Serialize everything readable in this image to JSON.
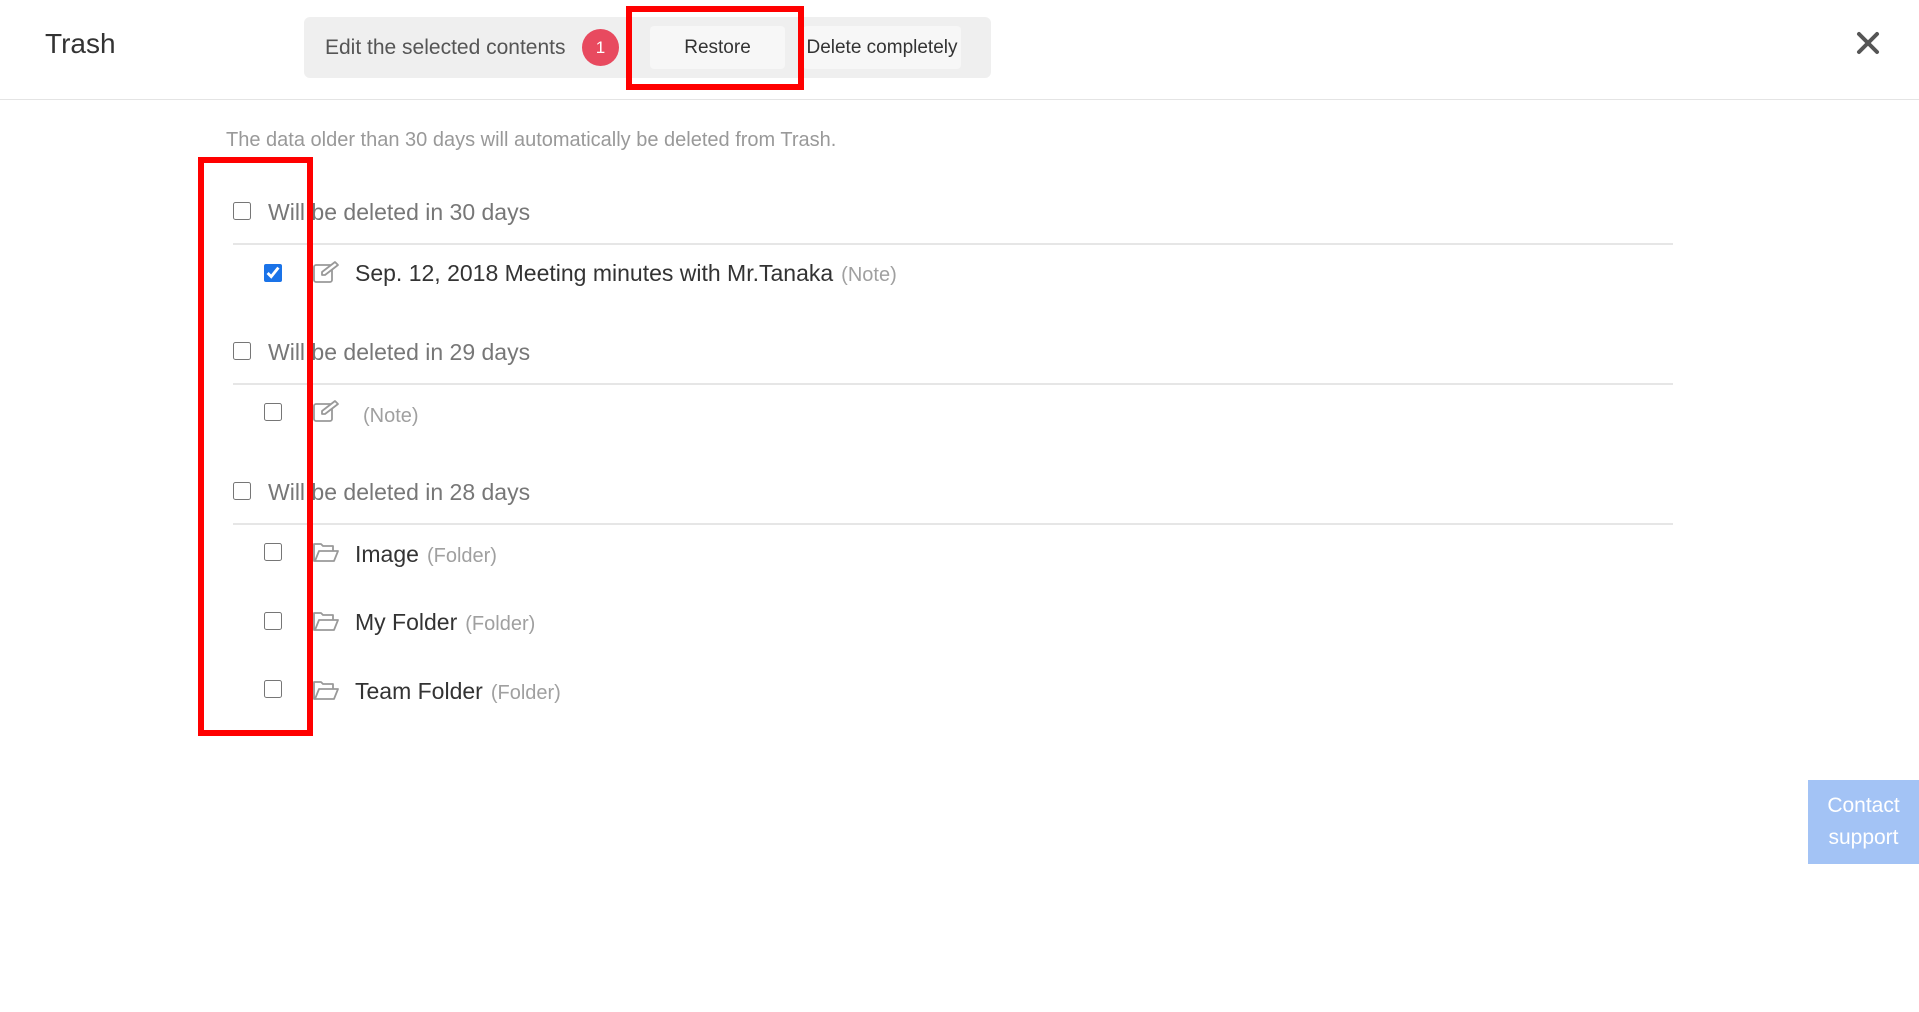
{
  "header": {
    "title": "Trash",
    "toolbar": {
      "label": "Edit the selected contents",
      "selected_count": "1",
      "restore_label": "Restore",
      "delete_label": "Delete completely"
    },
    "close_icon": "close-icon"
  },
  "info_text": "The data older than 30 days will automatically be deleted from Trash.",
  "groups": [
    {
      "label": "Will be deleted in 30 days",
      "checked": false,
      "items": [
        {
          "name": "Sep. 12, 2018 Meeting minutes with Mr.Tanaka",
          "type": "(Note)",
          "icon": "note-edit-icon",
          "checked": true
        }
      ]
    },
    {
      "label": "Will be deleted in 29 days",
      "checked": false,
      "items": [
        {
          "name": "",
          "type": "(Note)",
          "icon": "note-edit-icon",
          "checked": false
        }
      ]
    },
    {
      "label": "Will be deleted in 28 days",
      "checked": false,
      "items": [
        {
          "name": "Image",
          "type": "(Folder)",
          "icon": "folder-icon",
          "checked": false
        },
        {
          "name": "My Folder",
          "type": "(Folder)",
          "icon": "folder-icon",
          "checked": false
        },
        {
          "name": "Team Folder",
          "type": "(Folder)",
          "icon": "folder-icon",
          "checked": false
        }
      ]
    }
  ],
  "contact_support": "Contact support",
  "colors": {
    "badge": "#e84a5f",
    "highlight": "#ff0000",
    "contact_support_bg": "#a3c3f5",
    "checkbox_checked": "#1a73e8"
  }
}
